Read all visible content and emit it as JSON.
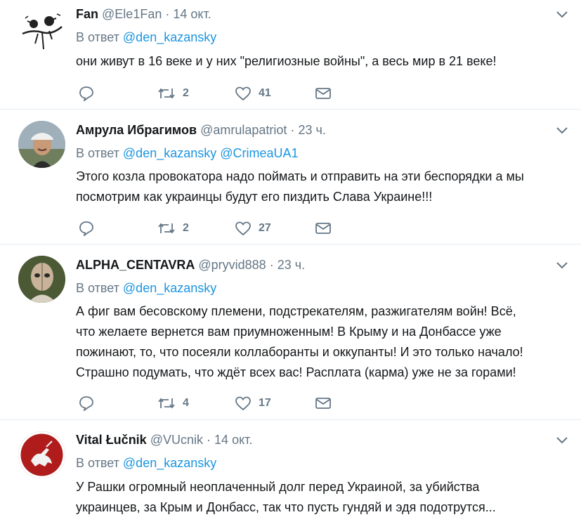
{
  "tweets": [
    {
      "name": "Fan",
      "handle": "@Ele1Fan",
      "time": "14 окт.",
      "reply_prefix": "В ответ",
      "mentions": [
        "@den_kazansky"
      ],
      "text_lines": [
        "они живут в 16 веке и у них \"религиозные войны\", а весь мир в 21 веке!"
      ],
      "retweets": "2",
      "likes": "41",
      "avatar_icon": "birds-on-branch"
    },
    {
      "name": "Амрула Ибрагимов",
      "handle": "@amrulapatriot",
      "time": "23 ч.",
      "reply_prefix": "В ответ",
      "mentions": [
        "@den_kazansky",
        "@CrimeaUA1"
      ],
      "text_lines": [
        "Этого козла провокатора надо поймать и отправить на эти беспорядки а мы",
        "посмотрим как украинцы будут его пиздить Слава Украине!!!"
      ],
      "retweets": "2",
      "likes": "27",
      "avatar_icon": "man-in-cap-photo"
    },
    {
      "name": "ALPHA_CENTAVRA",
      "handle": "@pryvid888",
      "time": "23 ч.",
      "reply_prefix": "В ответ",
      "mentions": [
        "@den_kazansky"
      ],
      "text_lines": [
        "А фиг вам бесовскому племени, подстрекателям, разжигателям войн! Всё,",
        "что желаете вернется вам приумноженным! В Крыму и на Донбассе уже",
        "пожинают, то, что посеяли коллаборанты и оккупанты! И это только начало!",
        "Страшно подумать, что ждёт всех вас! Расплата (карма) уже не за горами!"
      ],
      "retweets": "4",
      "likes": "17",
      "avatar_icon": "alien-face-photo"
    },
    {
      "name": "Vital Łučnik",
      "handle": "@VUcnik",
      "time": "14 окт.",
      "reply_prefix": "В ответ",
      "mentions": [
        "@den_kazansky"
      ],
      "text_lines": [
        "У Рашки огромный неоплаченный долг перед Украиной, за убийства",
        "украинцев, за Крым и Донбасс, так что пусть гундяй и эдя подотрутся..."
      ],
      "retweets": "",
      "likes": "",
      "avatar_icon": "pahonia-emblem"
    }
  ],
  "colors": {
    "text": "#14171a",
    "secondary": "#657786",
    "link": "#1b95e0",
    "divider": "#e6ecf0"
  }
}
